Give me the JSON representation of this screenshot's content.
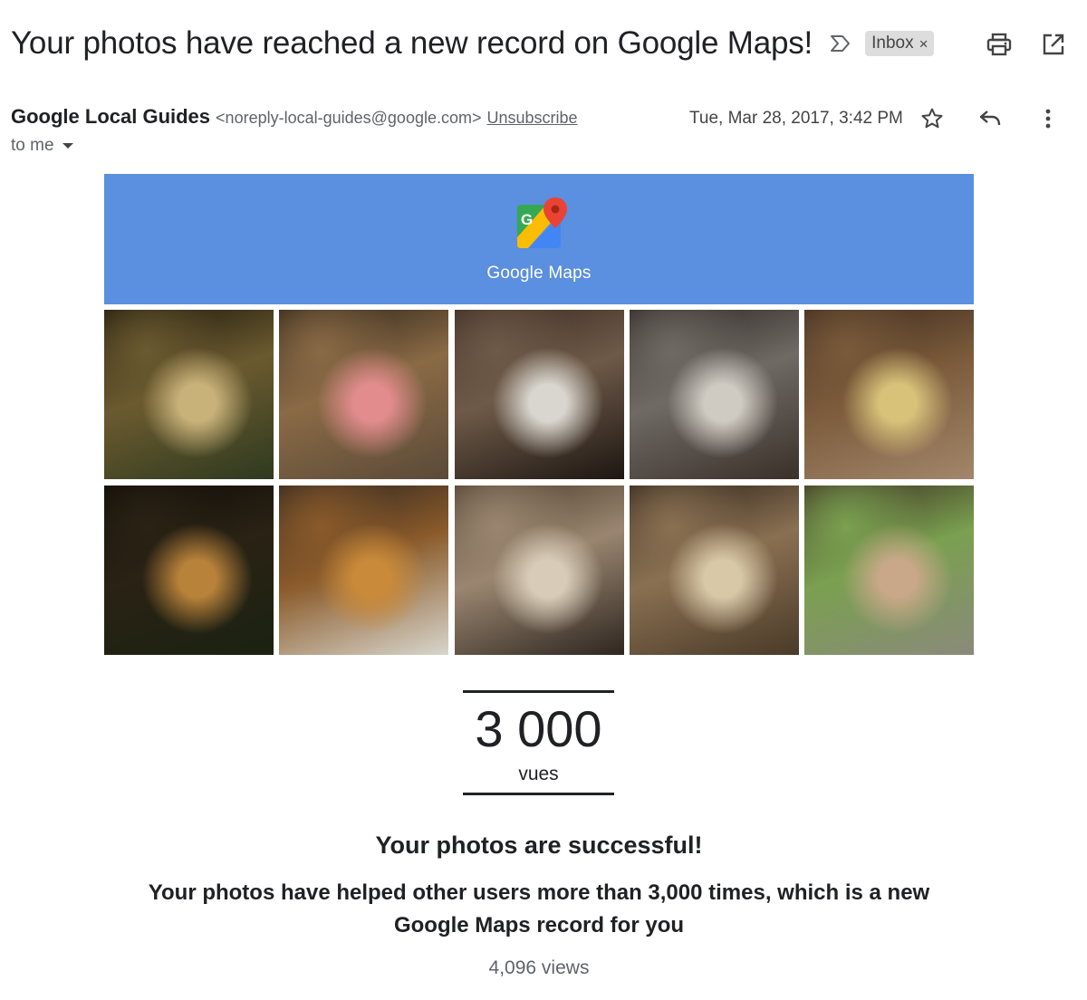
{
  "email": {
    "subject": "Your photos have reached a new record on Google Maps!",
    "label": "Inbox",
    "label_remove": "×",
    "sender_name": "Google Local Guides",
    "sender_email": "<noreply-local-guides@google.com>",
    "unsubscribe": "Unsubscribe",
    "date": "Tue, Mar 28, 2017, 3:42 PM",
    "recipient": "to me"
  },
  "banner": {
    "title": "Google Maps"
  },
  "photos": [
    {
      "name": "photo-lanterns-greenery",
      "colors": [
        "#1a150d",
        "#6b5a2f",
        "#c9b27a",
        "#2e3a1f"
      ]
    },
    {
      "name": "photo-bar-cocktail",
      "colors": [
        "#2a2218",
        "#8a6a45",
        "#e28c8e",
        "#5a4a38"
      ]
    },
    {
      "name": "photo-dessert-cup",
      "colors": [
        "#3a2a22",
        "#6e5a48",
        "#d9d6cf",
        "#1d1612"
      ]
    },
    {
      "name": "photo-hibiki-bottle",
      "colors": [
        "#2b2522",
        "#6f6a64",
        "#cfcac2",
        "#3b302a"
      ]
    },
    {
      "name": "photo-beer-glass",
      "colors": [
        "#3b2a1e",
        "#7a5a3a",
        "#d8c27a",
        "#a3866b"
      ]
    },
    {
      "name": "photo-dark-lanterns",
      "colors": [
        "#0e0b08",
        "#2a2214",
        "#b8823a",
        "#1a2212"
      ]
    },
    {
      "name": "photo-fried-cutlets",
      "colors": [
        "#2a2420",
        "#8a5a2a",
        "#c98a3a",
        "#d8d6cc"
      ]
    },
    {
      "name": "photo-restaurant-interior",
      "colors": [
        "#4a3a2a",
        "#9a8670",
        "#d8ccb8",
        "#2e2620"
      ]
    },
    {
      "name": "photo-gyoza-plate",
      "colors": [
        "#2a2018",
        "#8a7052",
        "#d8c8a8",
        "#4a3a28"
      ]
    },
    {
      "name": "photo-karaage-plate",
      "colors": [
        "#3a2a20",
        "#7aa050",
        "#c8a888",
        "#8a8a7a"
      ]
    }
  ],
  "stat": {
    "number": "3 000",
    "label": "vues"
  },
  "content": {
    "headline": "Your photos are successful!",
    "body": "Your photos have helped other users more than 3,000 times, which is a new Google Maps record for you",
    "views": "4,096 views"
  },
  "colors": {
    "banner": "#5b8fdf",
    "chip_bg": "#dddddd",
    "text": "#202124",
    "muted": "#5f6368"
  },
  "icons": [
    "importance-icon",
    "print-icon",
    "open-new-window-icon",
    "star-icon",
    "reply-icon",
    "more-vert-icon",
    "dropdown-arrow-icon",
    "google-maps-logo"
  ]
}
